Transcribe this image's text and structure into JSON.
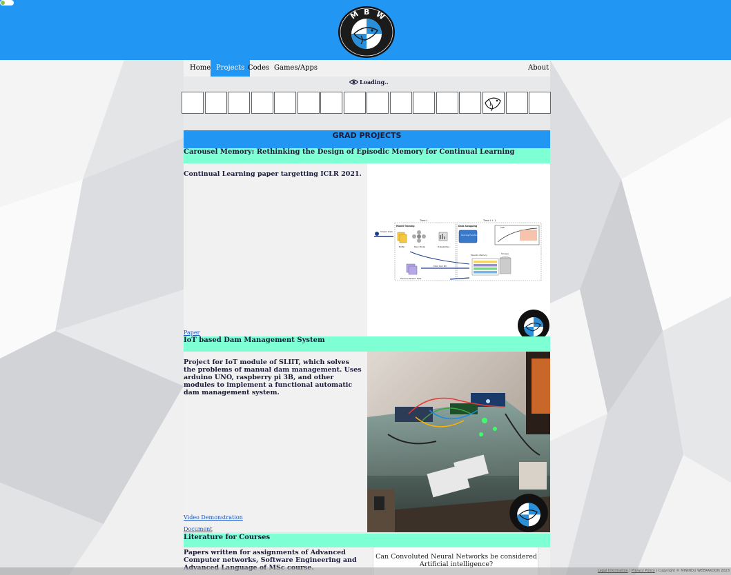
{
  "nav": {
    "home": "Home",
    "projects": "Projects",
    "codes": "Codes",
    "games": "Games/Apps",
    "about": "About"
  },
  "logo": {
    "letters": [
      "M",
      "B",
      "W"
    ]
  },
  "loading": {
    "text": "Loading.."
  },
  "section": {
    "title": "GRAD PROJECTS"
  },
  "projects": [
    {
      "title": "Carousel Memory: Rethinking the Design of Episodic Memory for Continual Learning",
      "description": "Continual Learning paper targetting ICLR 2021.",
      "links": [
        "Paper"
      ],
      "diagram": {
        "time_t": "Time t",
        "time_t1": "Time t + 1",
        "model_training": "Model Training",
        "data_swapping": "Data Swapping",
        "stream_data": "Stream Data",
        "buffer": "Buffer",
        "main_model": "Main Model",
        "probabilities": "Probabilities",
        "scoring_function": "Scoring Function",
        "cdf": "CDF",
        "episodic_memory": "Episodic Memory",
        "storage": "Storage",
        "previous_stream": "Previous Stream Data",
        "fetch": "Fetch from EM"
      }
    },
    {
      "title": "IoT based Dam Management System",
      "description": "Project for IoT module of SLIIT, which solves the problems of manual dam management. Uses arduino UNO, raspberry pi 3B, and other modules to implement a functional automatic dam management system.",
      "links": [
        "Video Demonstration",
        "Document"
      ]
    },
    {
      "title": "Literature for Courses",
      "description": "Papers written for assignments of Advanced Computer networks, Software Engineering and Advanced Language of MSc course.",
      "preview_title": "Can Convoluted Neural Networks be considered Artificial intelligence?"
    }
  ],
  "footer": {
    "legal": "Legal Information",
    "privacy": "Privacy Policy",
    "copyright": "Copyright © MININDU WEERAKOON 2023"
  },
  "colors": {
    "primary": "#2196f3",
    "accent_title": "#7fffd4",
    "panel": "#f1f1f1"
  }
}
